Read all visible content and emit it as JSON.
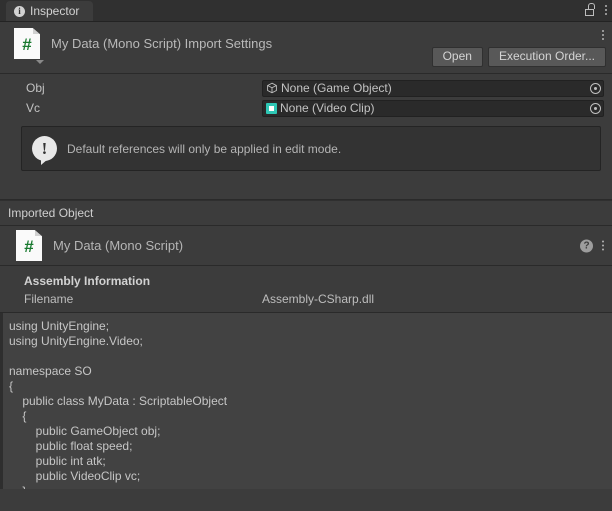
{
  "window": {
    "tab_label": "Inspector",
    "tab_icon": "info-icon",
    "lock_icon": "lock-icon",
    "menu_icon": "kebab-menu-icon"
  },
  "importer": {
    "title": "My Data (Mono Script) Import Settings",
    "icon": "csharp-script-icon",
    "menu_icon": "kebab-menu-icon",
    "buttons": {
      "open": "Open",
      "execution_order": "Execution Order..."
    }
  },
  "properties": [
    {
      "label": "Obj",
      "value": "None (Game Object)",
      "icon": "gameobject-cube-icon",
      "picker_icon": "object-picker-icon"
    },
    {
      "label": "Vc",
      "value": "None (Video Clip)",
      "icon": "videoclip-icon",
      "picker_icon": "object-picker-icon"
    }
  ],
  "helpbox": {
    "icon": "info-bubble-icon",
    "message": "Default references will only be applied in edit mode."
  },
  "imported_object": {
    "header": "Imported Object",
    "component_title": "My Data (Mono Script)",
    "component_icon": "csharp-script-icon",
    "help_icon": "help-icon",
    "menu_icon": "kebab-menu-icon"
  },
  "assembly_information": {
    "title": "Assembly Information",
    "filename_label": "Filename",
    "filename_value": "Assembly-CSharp.dll"
  },
  "code": "using UnityEngine;\nusing UnityEngine.Video;\n\nnamespace SO\n{\n    public class MyData : ScriptableObject\n    {\n        public GameObject obj;\n        public float speed;\n        public int atk;\n        public VideoClip vc;\n    }\n}",
  "colors": {
    "window_bg": "#3c3c3c",
    "tabbar_bg": "#303030",
    "field_bg": "#2a2a2a",
    "code_bg": "#424242",
    "script_green": "#1a7a30",
    "videoclip_teal": "#2ec7b5"
  }
}
